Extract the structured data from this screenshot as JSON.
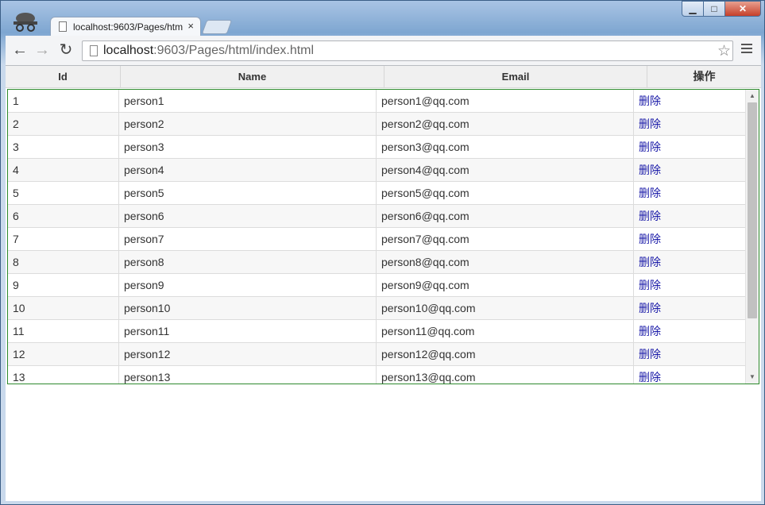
{
  "browser": {
    "tab_title": "localhost:9603/Pages/htm",
    "tab_close": "×",
    "url_host": "localhost",
    "url_rest": ":9603/Pages/html/index.html",
    "back_glyph": "←",
    "forward_glyph": "→",
    "reload_glyph": "↻",
    "star_glyph": "☆",
    "window_min": "▁",
    "window_max": "□",
    "window_close": "✕"
  },
  "table": {
    "headers": [
      "Id",
      "Name",
      "Email",
      "操作"
    ],
    "rows": [
      {
        "id": "1",
        "name": "person1",
        "email": "person1@qq.com",
        "action": "删除"
      },
      {
        "id": "2",
        "name": "person2",
        "email": "person2@qq.com",
        "action": "删除"
      },
      {
        "id": "3",
        "name": "person3",
        "email": "person3@qq.com",
        "action": "删除"
      },
      {
        "id": "4",
        "name": "person4",
        "email": "person4@qq.com",
        "action": "删除"
      },
      {
        "id": "5",
        "name": "person5",
        "email": "person5@qq.com",
        "action": "删除"
      },
      {
        "id": "6",
        "name": "person6",
        "email": "person6@qq.com",
        "action": "删除"
      },
      {
        "id": "7",
        "name": "person7",
        "email": "person7@qq.com",
        "action": "删除"
      },
      {
        "id": "8",
        "name": "person8",
        "email": "person8@qq.com",
        "action": "删除"
      },
      {
        "id": "9",
        "name": "person9",
        "email": "person9@qq.com",
        "action": "删除"
      },
      {
        "id": "10",
        "name": "person10",
        "email": "person10@qq.com",
        "action": "删除"
      },
      {
        "id": "11",
        "name": "person11",
        "email": "person11@qq.com",
        "action": "删除"
      },
      {
        "id": "12",
        "name": "person12",
        "email": "person12@qq.com",
        "action": "删除"
      },
      {
        "id": "13",
        "name": "person13",
        "email": "person13@qq.com",
        "action": "删除"
      }
    ]
  },
  "colors": {
    "grid_border": "#2d8a2d",
    "link": "#1a1aa8",
    "header_bg": "#f0f0f0"
  }
}
